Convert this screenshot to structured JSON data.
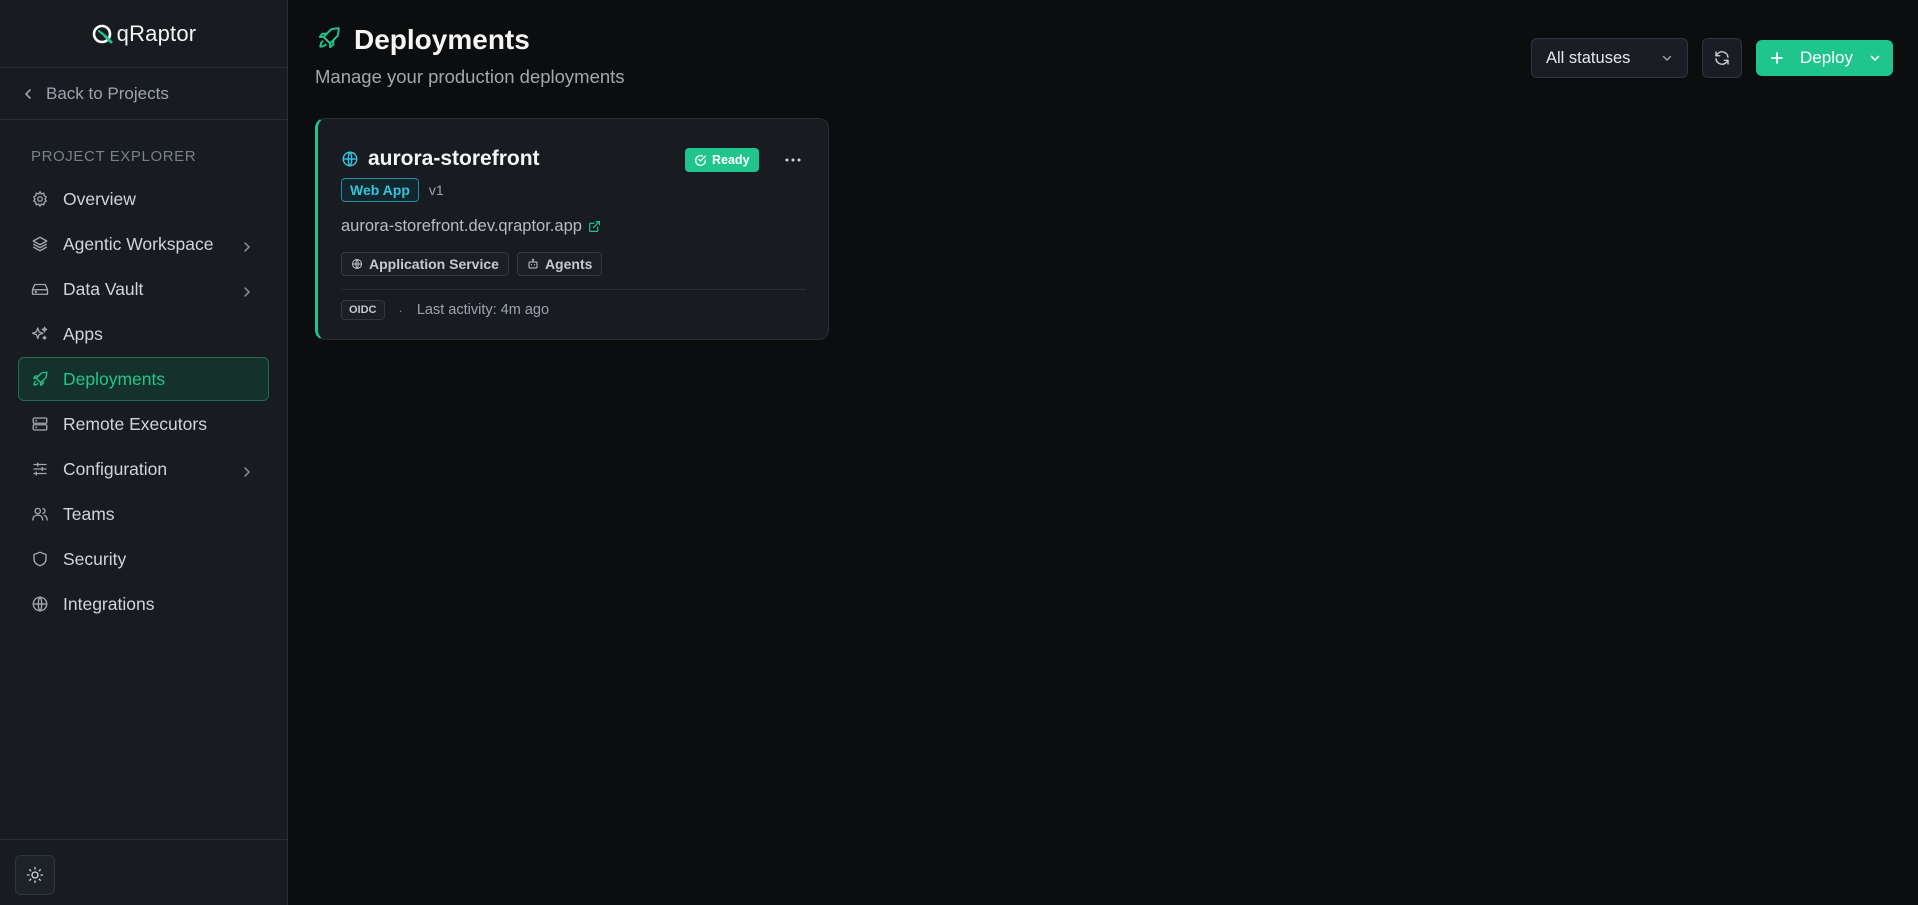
{
  "app": {
    "name": "qRaptor"
  },
  "sidebar": {
    "back_label": "Back to Projects",
    "section_label": "PROJECT EXPLORER",
    "items": [
      {
        "label": "Overview",
        "icon": "gear-icon",
        "has_submenu": false,
        "active": false
      },
      {
        "label": "Agentic Workspace",
        "icon": "layers-icon",
        "has_submenu": true,
        "active": false
      },
      {
        "label": "Data Vault",
        "icon": "drive-icon",
        "has_submenu": true,
        "active": false
      },
      {
        "label": "Apps",
        "icon": "sparkles-icon",
        "has_submenu": false,
        "active": false
      },
      {
        "label": "Deployments",
        "icon": "rocket-icon",
        "has_submenu": false,
        "active": true
      },
      {
        "label": "Remote Executors",
        "icon": "server-icon",
        "has_submenu": false,
        "active": false
      },
      {
        "label": "Configuration",
        "icon": "sliders-icon",
        "has_submenu": true,
        "active": false
      },
      {
        "label": "Teams",
        "icon": "users-icon",
        "has_submenu": false,
        "active": false
      },
      {
        "label": "Security",
        "icon": "shield-icon",
        "has_submenu": false,
        "active": false
      },
      {
        "label": "Integrations",
        "icon": "globe-icon",
        "has_submenu": false,
        "active": false
      }
    ]
  },
  "header": {
    "title": "Deployments",
    "subtitle": "Manage your production deployments"
  },
  "toolbar": {
    "status_filter": "All statuses",
    "deploy_label": "Deploy"
  },
  "deployments": [
    {
      "name": "aurora-storefront",
      "status": "Ready",
      "type": "Web App",
      "version": "v1",
      "url": "aurora-storefront.dev.qraptor.app",
      "services": [
        "Application Service",
        "Agents"
      ],
      "auth": "OIDC",
      "separator": "·",
      "last_activity": "Last activity: 4m ago"
    }
  ],
  "colors": {
    "accent": "#1fc58d",
    "background": "#0c0d0f",
    "sidebar": "#181c21",
    "badge_cyan": "#36c3e0"
  }
}
